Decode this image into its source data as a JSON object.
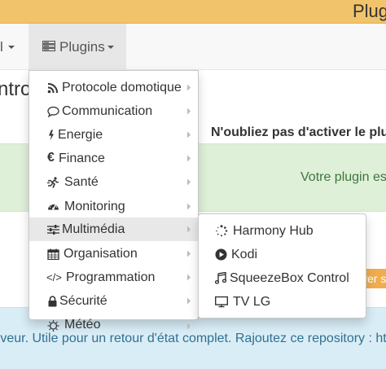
{
  "window": {
    "title": "Plug"
  },
  "navbar": {
    "prev_fragment": "l",
    "plugins_label": "Plugins"
  },
  "page": {
    "title_fragment": "ntro",
    "warning_text": "N'oubliez pas d'activer le plu",
    "success_text": "Votre plugin es",
    "button_fragment": "yer s",
    "info_text": "rveur. Utile pour un retour d'état complet. Rajoutez ce repository : htt"
  },
  "menu": {
    "items": [
      {
        "label": "Protocole domotique",
        "icon": "rss-icon"
      },
      {
        "label": "Communication",
        "icon": "comment-icon"
      },
      {
        "label": "Energie",
        "icon": "bolt-icon"
      },
      {
        "label": "Finance",
        "icon": "euro-icon"
      },
      {
        "label": "Santé",
        "icon": "running-icon"
      },
      {
        "label": "Monitoring",
        "icon": "dashboard-icon"
      },
      {
        "label": "Multimédia",
        "icon": "sliders-icon",
        "active": true
      },
      {
        "label": "Organisation",
        "icon": "calendar-icon"
      },
      {
        "label": "Programmation",
        "icon": "code-icon"
      },
      {
        "label": "Sécurité",
        "icon": "lock-icon"
      },
      {
        "label": "Météo",
        "icon": "sun-icon"
      }
    ],
    "submenu": [
      {
        "label": "Harmony Hub",
        "icon": "spinner-icon"
      },
      {
        "label": "Kodi",
        "icon": "play-circle-icon"
      },
      {
        "label": "SqueezeBox Control",
        "icon": "music-icon",
        "highlighted": true
      },
      {
        "label": "TV LG",
        "icon": "tv-icon"
      }
    ]
  },
  "colors": {
    "titlebar": "#f1c36b",
    "navbar": "#f8f8f8",
    "success_bg": "#dff0d8",
    "success_text": "#3c763d",
    "info_bg": "#d9edf7",
    "info_text": "#31708f",
    "highlight": "#ffff2a",
    "warning_button": "#f0ad4e"
  }
}
